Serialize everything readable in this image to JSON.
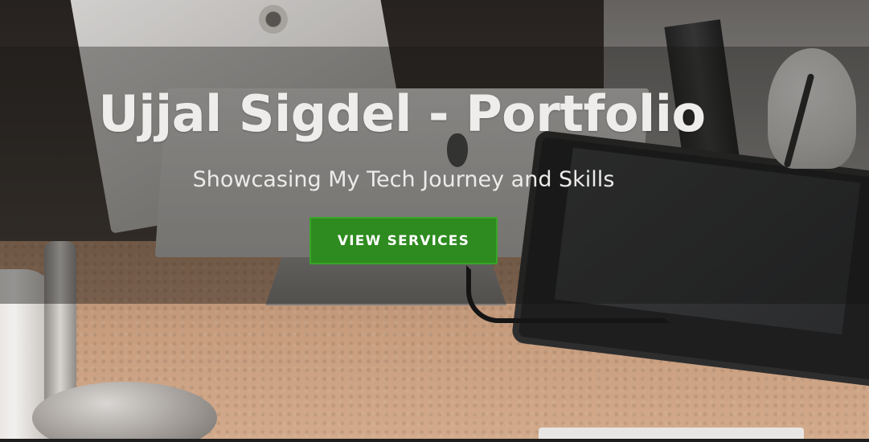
{
  "hero": {
    "title": "Ujjal Sigdel - Portfolio",
    "subtitle": "Showcasing My Tech Journey and Skills",
    "cta_label": "VIEW SERVICES",
    "cta_color": "#2e8b1f",
    "background_image": "desk-workspace-photo"
  }
}
